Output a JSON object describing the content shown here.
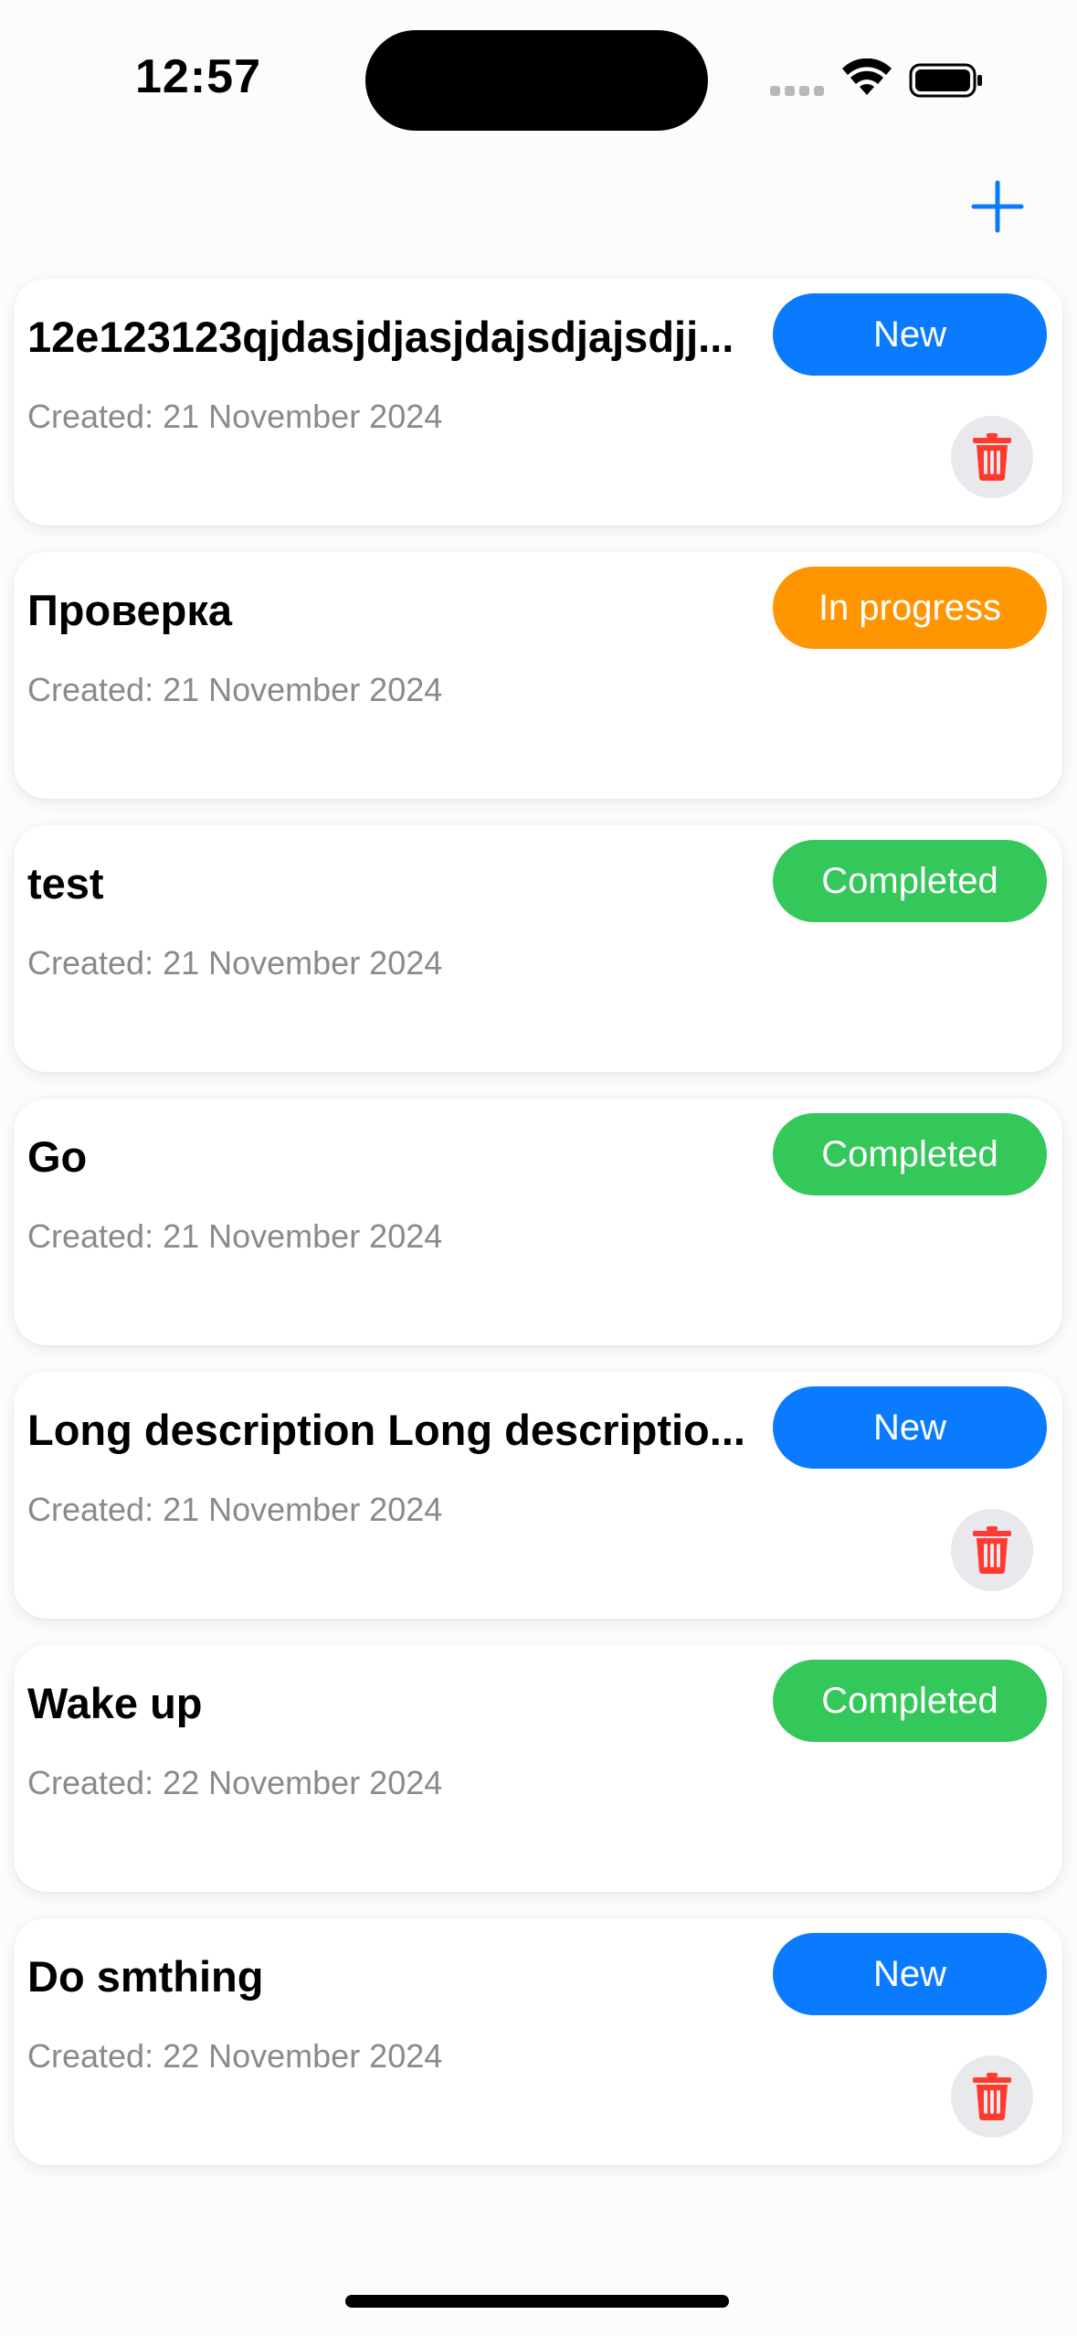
{
  "status_bar": {
    "time": "12:57"
  },
  "toolbar": {
    "add_icon": "plus-icon",
    "accent_color": "#0a7aff"
  },
  "tasks": [
    {
      "title": "12e123123qjdasjdjasjdajsdjajsdjj...",
      "created": "Created: 21 November 2024",
      "status": "New",
      "deletable": true
    },
    {
      "title": "Проверка",
      "created": "Created: 21 November 2024",
      "status": "In progress",
      "deletable": false
    },
    {
      "title": "test",
      "created": "Created: 21 November 2024",
      "status": "Completed",
      "deletable": false
    },
    {
      "title": "Go",
      "created": "Created: 21 November 2024",
      "status": "Completed",
      "deletable": false
    },
    {
      "title": "Long description Long descriptio...",
      "created": "Created: 21 November 2024",
      "status": "New",
      "deletable": true
    },
    {
      "title": "Wake up",
      "created": "Created: 22 November 2024",
      "status": "Completed",
      "deletable": false
    },
    {
      "title": "Do smthing",
      "created": "Created: 22 November 2024",
      "status": "New",
      "deletable": true
    }
  ],
  "status_colors": {
    "New": "#0a7aff",
    "In progress": "#ff9500",
    "Completed": "#34c759"
  },
  "delete_icon": "trash-icon",
  "delete_icon_color": "#ff3b30"
}
